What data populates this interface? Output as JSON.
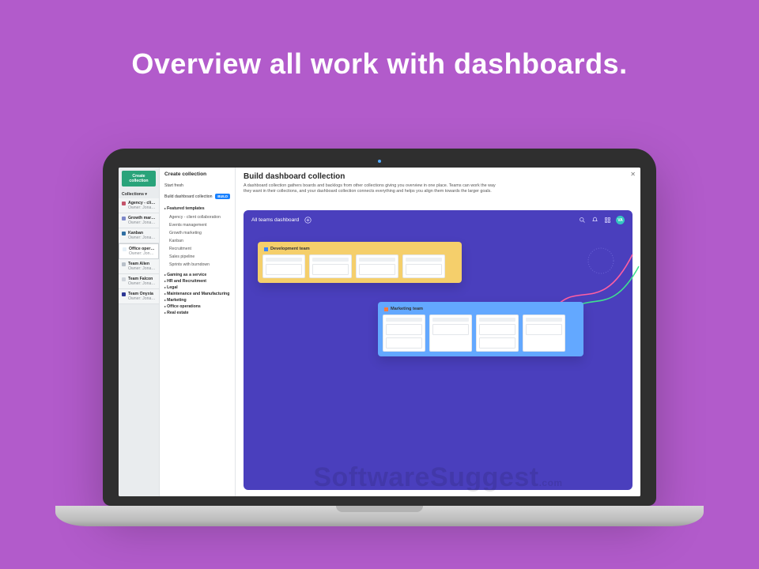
{
  "hero": {
    "title": "Overview all work with dashboards."
  },
  "watermark": {
    "brand": "SoftwareSuggest",
    "tld": ".com"
  },
  "left": {
    "create": "Create collection",
    "header": "Collections ▾",
    "items": [
      {
        "name": "Agency - client",
        "owner": "Owner: Jonathan",
        "color": "#c4536a"
      },
      {
        "name": "Growth marketing",
        "owner": "Owner: Jonathan",
        "color": "#7e89c9"
      },
      {
        "name": "Kanban",
        "owner": "Owner: Jonathan",
        "color": "#2f6fa3"
      },
      {
        "name": "Office operations",
        "owner": "Owner: Jonathan",
        "color": "#e6f0f7",
        "selected": true
      },
      {
        "name": "Team Alien",
        "owner": "Owner: Jonathan",
        "color": "#b8c0c9"
      },
      {
        "name": "Team Falcon",
        "owner": "Owner: Jonathan",
        "color": "#d0d5db"
      },
      {
        "name": "Team Onyxia",
        "owner": "Owner: Jonathan",
        "color": "#2d3795"
      }
    ]
  },
  "mid": {
    "title": "Create collection",
    "start_fresh": "Start fresh",
    "build_dash": "Build dashboard collection",
    "build_badge": "BUILD",
    "featured": "Featured templates",
    "templates": [
      "Agency - client collaboration",
      "Events management",
      "Growth marketing",
      "Kanban",
      "Recruitment",
      "Sales pipeline",
      "Sprints with burndown"
    ],
    "groups": [
      "Gaming as a service",
      "HR and Recruitment",
      "Legal",
      "Maintenance and Manufacturing",
      "Marketing",
      "Office operations",
      "Real estate"
    ]
  },
  "main": {
    "title": "Build dashboard collection",
    "desc": "A dashboard collection gathers boards and backlogs from other collections giving you overview in one place. Teams can work the way they want in their collections, and your dashboard collection connects everything and helps you align them towards the larger goals."
  },
  "preview": {
    "title": "All teams dashboard",
    "avatar": "VA",
    "boards": {
      "dev": "Development team",
      "mkt": "Marketing team"
    }
  },
  "colors": {
    "purple_bg": "#b25bcb",
    "preview_bg": "#4a3fbd",
    "dev_board": "#f5cf6b",
    "mkt_board": "#63a8ff",
    "accent_blue": "#1981ff",
    "accent_green": "#29a37a"
  }
}
